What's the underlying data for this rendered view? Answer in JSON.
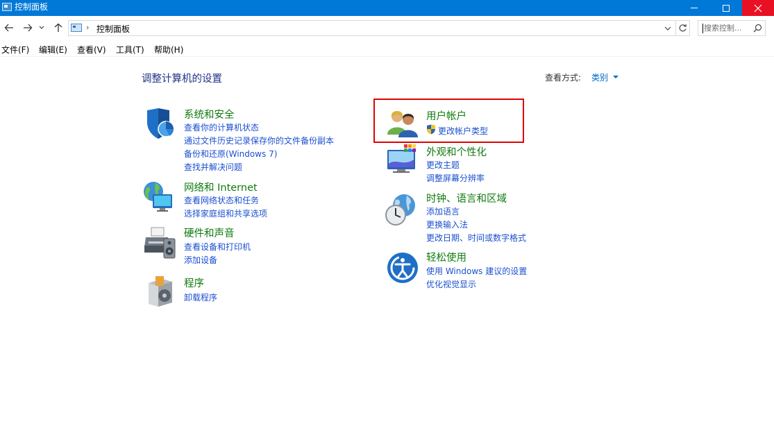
{
  "window": {
    "title": "控制面板"
  },
  "address": {
    "path": "控制面板",
    "separator": "›"
  },
  "search": {
    "placeholder": "搜索控制..."
  },
  "menu": [
    "文件(F)",
    "编辑(E)",
    "查看(V)",
    "工具(T)",
    "帮助(H)"
  ],
  "content": {
    "heading": "调整计算机的设置",
    "view_by_label": "查看方式:",
    "view_by_value": "类别"
  },
  "left_categories": [
    {
      "title": "系统和安全",
      "links": [
        "查看你的计算机状态",
        "通过文件历史记录保存你的文件备份副本",
        "备份和还原(Windows 7)",
        "查找并解决问题"
      ]
    },
    {
      "title": "网络和 Internet",
      "links": [
        "查看网络状态和任务",
        "选择家庭组和共享选项"
      ]
    },
    {
      "title": "硬件和声音",
      "links": [
        "查看设备和打印机",
        "添加设备"
      ]
    },
    {
      "title": "程序",
      "links": [
        "卸载程序"
      ]
    }
  ],
  "right_categories": [
    {
      "title": "用户帐户",
      "links": [
        "更改帐户类型"
      ]
    },
    {
      "title": "外观和个性化",
      "links": [
        "更改主题",
        "调整屏幕分辨率"
      ]
    },
    {
      "title": "时钟、语言和区域",
      "links": [
        "添加语言",
        "更换输入法",
        "更改日期、时间或数字格式"
      ]
    },
    {
      "title": "轻松使用",
      "links": [
        "使用 Windows 建议的设置",
        "优化视觉显示"
      ]
    }
  ],
  "colors": {
    "titlebar": "#0078d7",
    "close": "#e81123",
    "category_title": "#0e7a0e",
    "link": "#1a4fd0",
    "heading": "#1e3287",
    "highlight": "#e00000"
  }
}
